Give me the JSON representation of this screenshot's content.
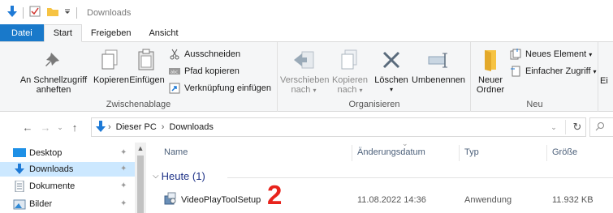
{
  "window": {
    "title": "Downloads"
  },
  "ribbon_tabs": [
    "Datei",
    "Start",
    "Freigeben",
    "Ansicht"
  ],
  "clipboard": {
    "pin_label_1": "An Schnellzugriff",
    "pin_label_2": "anheften",
    "copy_label": "Kopieren",
    "paste_label": "Einfügen",
    "cut_label": "Ausschneiden",
    "copy_path_label": "Pfad kopieren",
    "paste_shortcut_label": "Verknüpfung einfügen",
    "group_label": "Zwischenablage"
  },
  "organize": {
    "move_label_1": "Verschieben",
    "move_label_2": "nach",
    "copyto_label_1": "Kopieren",
    "copyto_label_2": "nach",
    "delete_label": "Löschen",
    "rename_label": "Umbenennen",
    "group_label": "Organisieren"
  },
  "new": {
    "new_folder_label_1": "Neuer",
    "new_folder_label_2": "Ordner",
    "new_item_label": "Neues Element",
    "easy_access_label": "Einfacher Zugriff",
    "group_label": "Neu",
    "cut_off_label": "Ei"
  },
  "address": {
    "crumbs": [
      "Dieser PC",
      "Downloads"
    ]
  },
  "nav_pane": {
    "items": [
      {
        "label": "Desktop"
      },
      {
        "label": "Downloads"
      },
      {
        "label": "Dokumente"
      },
      {
        "label": "Bilder"
      }
    ]
  },
  "file_list": {
    "columns": {
      "name": "Name",
      "date": "Änderungsdatum",
      "type": "Typ",
      "size": "Größe"
    },
    "group_header": "Heute (1)",
    "rows": [
      {
        "name": "VideoPlayToolSetup",
        "date": "11.08.2022 14:36",
        "type": "Anwendung",
        "size": "11.932 KB"
      }
    ]
  },
  "annotation": {
    "label": "2",
    "color": "#e8231c"
  },
  "colors": {
    "accent": "#1979ca",
    "selected": "#cce8ff",
    "ribbon_bg": "#f5f6f7"
  }
}
